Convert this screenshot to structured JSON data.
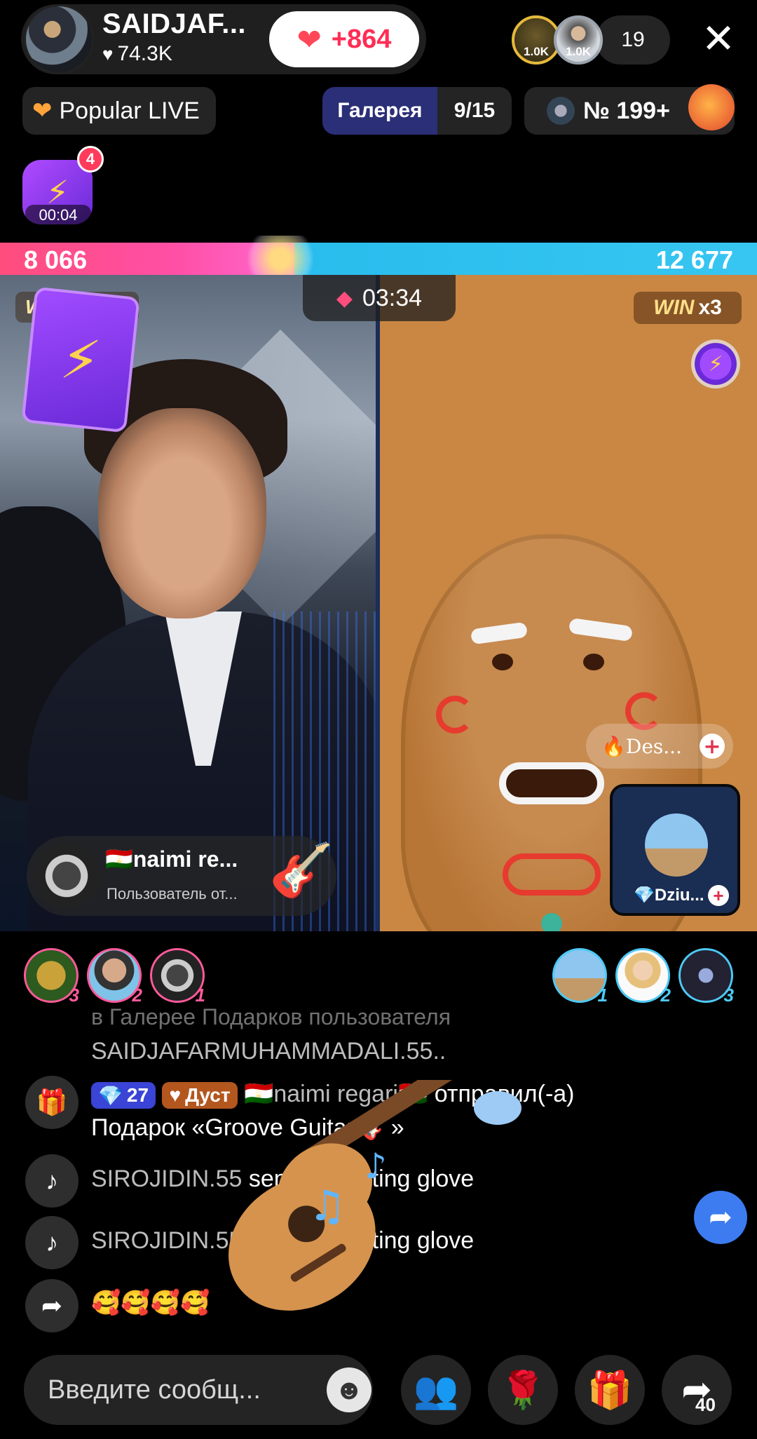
{
  "host": {
    "name": "SAIDJAF...",
    "likes": "74.3K",
    "like_button": "+864"
  },
  "viewers": {
    "top1_badge": "1.0K",
    "top2_badge": "1.0K",
    "count": "19"
  },
  "chips": {
    "popular": "Popular LIVE",
    "gallery_label": "Галерея",
    "gallery_count": "9/15",
    "rank": "№ 199+"
  },
  "boost": {
    "badge": "4",
    "timer": "00:04"
  },
  "battle": {
    "score_left": "8 066",
    "score_right": "12 677",
    "score_left_value": 8066,
    "score_right_value": 12677,
    "timer": "03:34",
    "win_right_prefix": "WIN",
    "win_right_mult": "x3",
    "win_left": "W"
  },
  "guest_pill": {
    "name": "🔥Des..."
  },
  "guest_card": {
    "name": "💎Dziu..."
  },
  "gift_popup": {
    "name": "🇹🇯naimi re...",
    "subtitle": "Пользователь  от..."
  },
  "gifters_left": [
    "3",
    "2",
    "1"
  ],
  "gifters_right": [
    "1",
    "2",
    "3"
  ],
  "chat": {
    "line0": "в Галерее Подарков пользователя",
    "line1": "SAIDJAFARMUHAMMADALI.55..",
    "gift_level": "27",
    "gift_fan": "Дуст",
    "gift_user": "🇹🇯naimi regari🇹🇯",
    "gift_action": " отправил(-а)",
    "gift_text": "Подарок «Groove Guitar 🎸»",
    "msg1_user": "SIROJIDIN.55",
    "msg1_text": " sent 1 boosting glove",
    "msg2_user": "SIROJIDIN.55",
    "msg2_text": " sent 1 boosting glove",
    "msg3_text": "🥰🥰🥰🥰"
  },
  "bottom": {
    "input_placeholder": "Введите сообщ...",
    "share_count": "40"
  }
}
